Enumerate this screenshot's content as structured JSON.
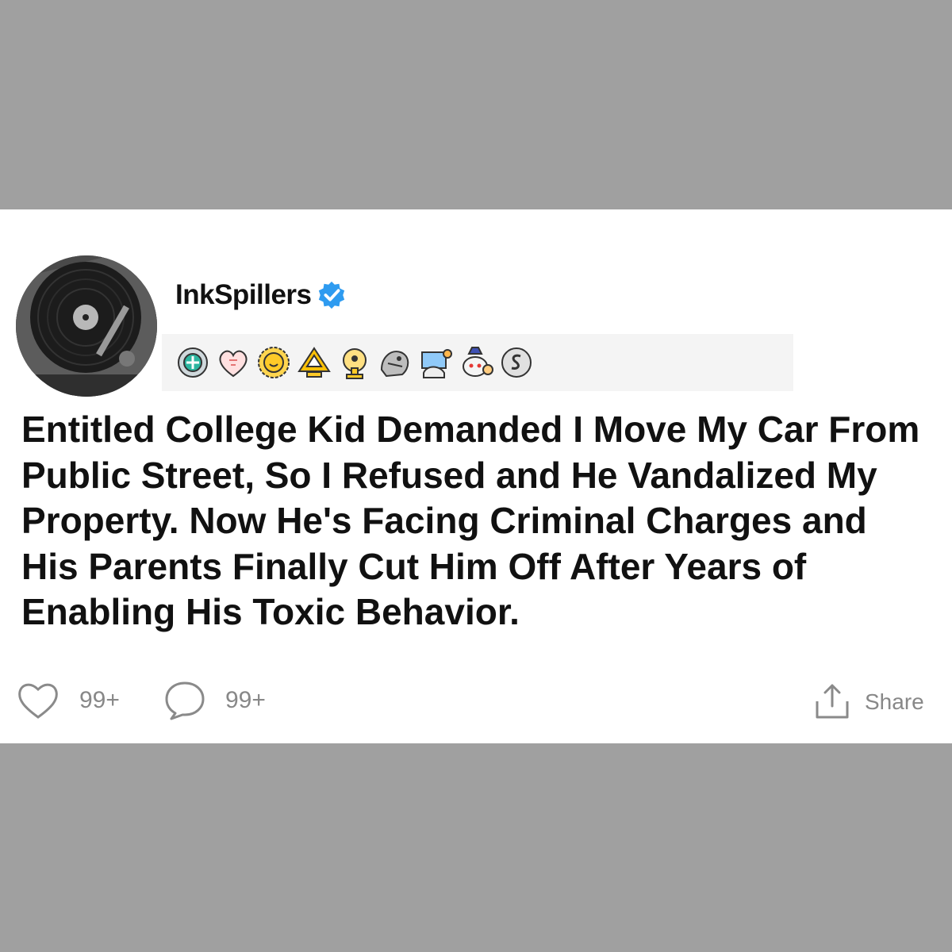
{
  "post": {
    "username": "InkSpillers",
    "headline": "Entitled College Kid Demanded I Move My Car From Public Street, So I Refused and He Vandalized My Property. Now He's Facing Criminal Charges and His Parents Finally Cut Him Off After Years of Enabling His Toxic Behavior.",
    "likes": "99+",
    "comments": "99+",
    "share_label": "Share"
  },
  "icons": {
    "avatar": "record-player-icon",
    "verified": "verified-check-icon",
    "badges": [
      "helper-badge-icon",
      "heart-badge-icon",
      "sun-badge-icon",
      "upvote-badge-icon",
      "trophy-badge-icon",
      "hug-badge-icon",
      "party-badge-icon",
      "snoo-badge-icon",
      "silver-badge-icon"
    ],
    "like": "heart-icon",
    "comment": "comment-icon",
    "share": "share-icon"
  },
  "colors": {
    "background_band": "#a0a0a0",
    "card": "#ffffff",
    "verified_blue": "#2e9bf0",
    "muted_text": "#888888"
  }
}
